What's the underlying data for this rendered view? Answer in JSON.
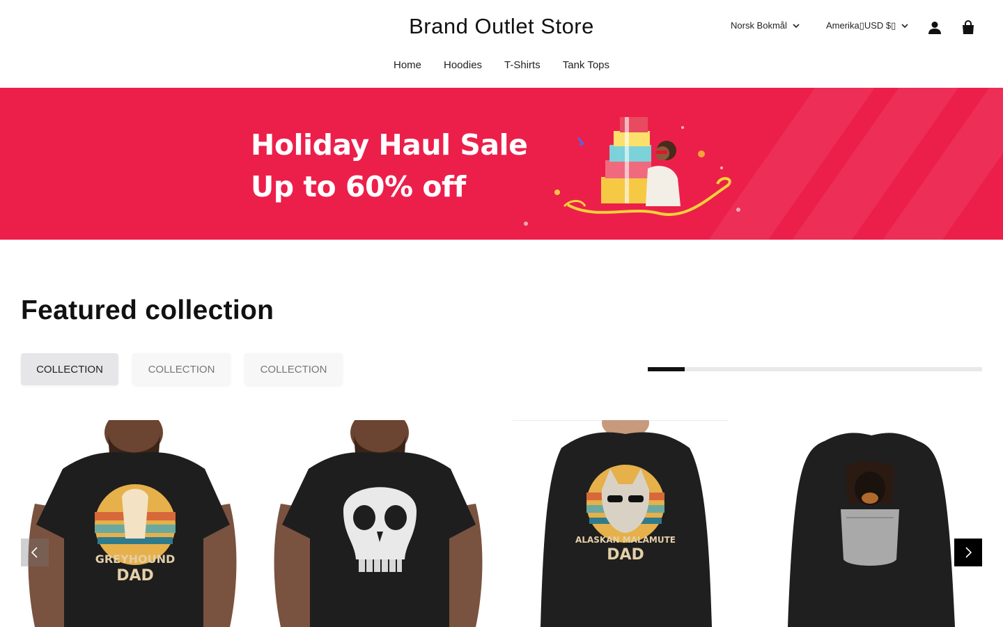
{
  "header": {
    "brand": "Brand Outlet Store",
    "language": "Norsk Bokmål",
    "currency": "Amerika▯USD $▯",
    "account_icon": "account-icon",
    "cart_icon": "shopping-bag-icon"
  },
  "nav": {
    "items": [
      {
        "label": "Home"
      },
      {
        "label": "Hoodies"
      },
      {
        "label": "T-Shirts"
      },
      {
        "label": "Tank Tops"
      }
    ]
  },
  "banner": {
    "line1": "Holiday Haul Sale",
    "line2": "Up to 60% off",
    "background": "#ec1f4b"
  },
  "featured": {
    "title": "Featured collection",
    "tabs": [
      {
        "label": "COLLECTION",
        "active": true
      },
      {
        "label": "COLLECTION",
        "active": false
      },
      {
        "label": "COLLECTION",
        "active": false
      }
    ],
    "scroll_progress": 0.11
  },
  "products": {
    "items": [
      {
        "print_line1": "GREYHOUND",
        "print_line2": "DAD"
      },
      {
        "print_line1": "",
        "print_line2": ""
      },
      {
        "print_line1": "ALASKAN MALAMUTE",
        "print_line2": "DAD"
      },
      {
        "print_line1": "",
        "print_line2": ""
      }
    ],
    "prev_icon": "chevron-left-icon",
    "next_icon": "chevron-right-icon"
  }
}
